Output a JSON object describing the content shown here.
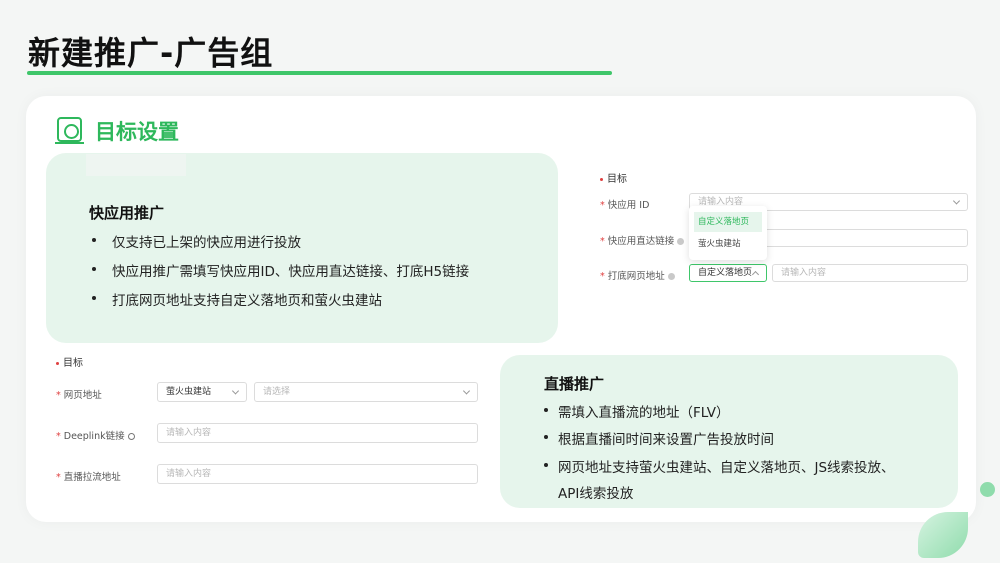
{
  "page": {
    "title": "新建推广-广告组"
  },
  "section": {
    "title": "目标设置",
    "icon": "target-book-icon"
  },
  "quickapp": {
    "title": "快应用推广",
    "bullets": [
      "仅支持已上架的快应用进行投放",
      "快应用推广需填写快应用ID、快应用直达链接、打底H5链接",
      "打底网页地址支持自定义落地页和萤火虫建站"
    ]
  },
  "livestream": {
    "title": "直播推广",
    "bullets": [
      "需填入直播流的地址（FLV）",
      "根据直播间时间来设置广告投放时间",
      "网页地址支持萤火虫建站、自定义落地页、JS线索投放、",
      "API线索投放"
    ]
  },
  "form_quickapp": {
    "heading": "目标",
    "quickapp_id": {
      "label": "快应用 ID",
      "placeholder": "请输入内容"
    },
    "direct_link": {
      "label": "快应用直达链接"
    },
    "fallback_url": {
      "label": "打底网页地址",
      "selected": "自定义落地页",
      "placeholder": "请输入内容"
    },
    "dropdown_options": [
      "自定义落地页",
      "萤火虫建站"
    ]
  },
  "form_live": {
    "heading": "目标",
    "web_url": {
      "label": "网页地址",
      "selected": "萤火虫建站",
      "placeholder": "请选择"
    },
    "deeplink": {
      "label": "Deeplink链接",
      "placeholder": "请输入内容"
    },
    "stream_url": {
      "label": "直播拉流地址",
      "placeholder": "请输入内容"
    }
  },
  "colors": {
    "accent": "#2eb85c",
    "title_bar": "#3fc66a",
    "box_bg": "#e6f5ec",
    "required": "#e04040"
  }
}
